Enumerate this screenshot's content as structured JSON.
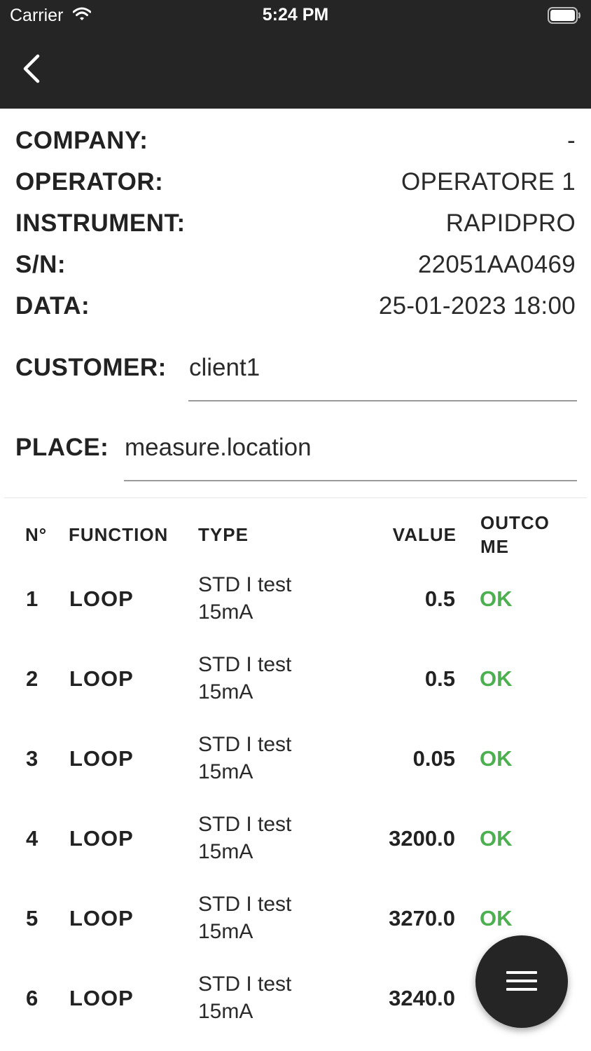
{
  "status_bar": {
    "carrier": "Carrier",
    "time": "5:24 PM"
  },
  "info": [
    {
      "label": "COMPANY:",
      "value": "-"
    },
    {
      "label": "OPERATOR:",
      "value": "OPERATORE 1"
    },
    {
      "label": "INSTRUMENT:",
      "value": "RAPIDPRO"
    },
    {
      "label": "S/N:",
      "value": "22051AA0469"
    },
    {
      "label": "DATA:",
      "value": "25-01-2023 18:00"
    }
  ],
  "customer": {
    "label": "CUSTOMER:",
    "value": "client1"
  },
  "place": {
    "label": "PLACE:",
    "value": "measure.location"
  },
  "table": {
    "headers": {
      "n": "N°",
      "function": "FUNCTION",
      "type": "TYPE",
      "value": "VALUE",
      "outcome_1": "OUTCO",
      "outcome_2": "ME"
    },
    "rows": [
      {
        "n": "1",
        "function": "LOOP",
        "type_1": "STD I test",
        "type_2": "15mA",
        "value": "0.5",
        "outcome": "OK"
      },
      {
        "n": "2",
        "function": "LOOP",
        "type_1": "STD I test",
        "type_2": "15mA",
        "value": "0.5",
        "outcome": "OK"
      },
      {
        "n": "3",
        "function": "LOOP",
        "type_1": "STD I test",
        "type_2": "15mA",
        "value": "0.05",
        "outcome": "OK"
      },
      {
        "n": "4",
        "function": "LOOP",
        "type_1": "STD I test",
        "type_2": "15mA",
        "value": "3200.0",
        "outcome": "OK"
      },
      {
        "n": "5",
        "function": "LOOP",
        "type_1": "STD I test",
        "type_2": "15mA",
        "value": "3270.0",
        "outcome": "OK"
      },
      {
        "n": "6",
        "function": "LOOP",
        "type_1": "STD I test",
        "type_2": "15mA",
        "value": "3240.0",
        "outcome": ""
      }
    ]
  },
  "colors": {
    "header_bg": "#252525",
    "ok": "#4caf50"
  },
  "icons": {
    "back": "chevron-left-icon",
    "menu": "hamburger-menu-icon"
  }
}
